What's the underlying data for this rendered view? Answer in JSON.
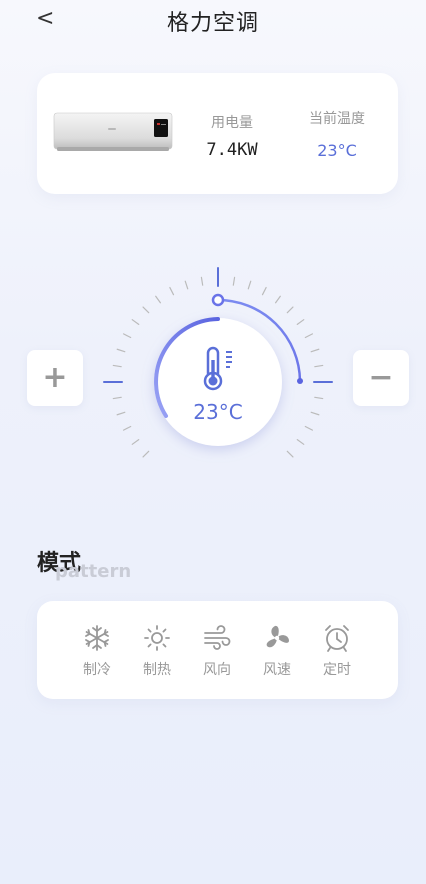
{
  "header": {
    "back_icon": "chevron-left-icon",
    "back_glyph": "<",
    "title": "格力空调"
  },
  "info_card": {
    "power_label": "用电量",
    "power_value": "7.4KW",
    "temp_label": "当前温度",
    "temp_value": "23°C"
  },
  "controls": {
    "plus_label": "+",
    "minus_label": "−"
  },
  "dial": {
    "temperature": "23°C",
    "icon": "thermometer-icon",
    "accent_color": "#5a6fd8",
    "level": 0.42
  },
  "mode": {
    "title": "模式",
    "subtitle": "pattern",
    "items": [
      {
        "label": "制冷",
        "icon": "snowflake-icon"
      },
      {
        "label": "制热",
        "icon": "sun-icon"
      },
      {
        "label": "风向",
        "icon": "wind-icon"
      },
      {
        "label": "风速",
        "icon": "fan-icon"
      },
      {
        "label": "定时",
        "icon": "alarm-clock-icon"
      }
    ]
  }
}
